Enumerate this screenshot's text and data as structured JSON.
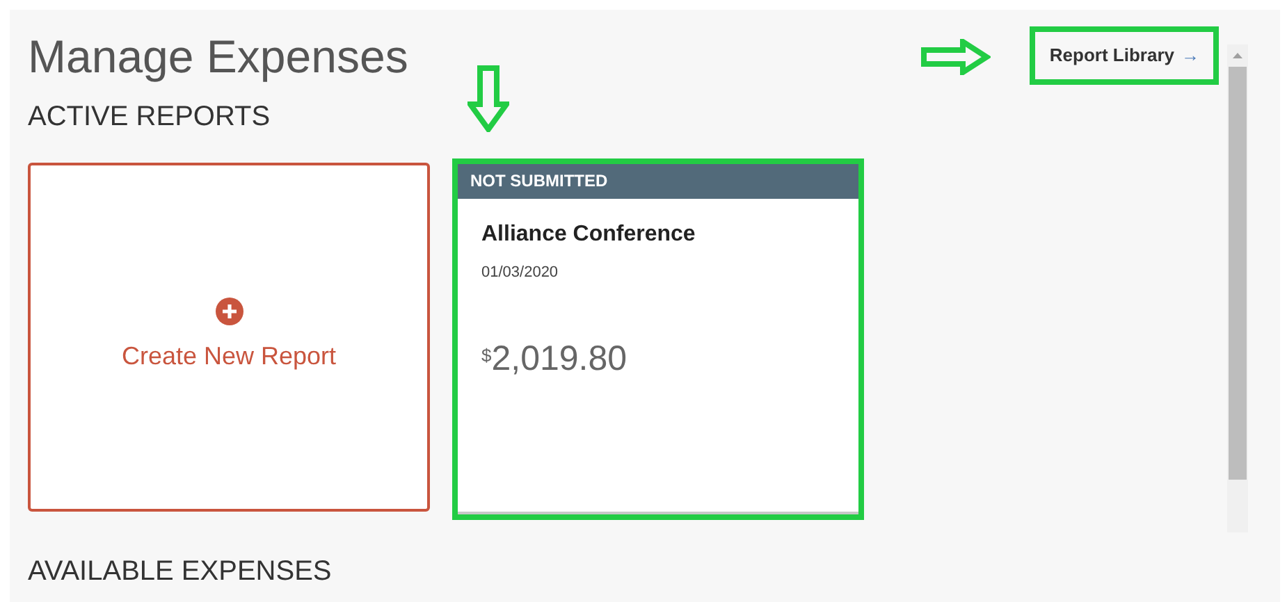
{
  "title": "Manage Expenses",
  "report_library": {
    "label": "Report Library",
    "arrow": "→"
  },
  "active_reports": {
    "heading": "ACTIVE REPORTS",
    "create_card": {
      "label": "Create New Report"
    },
    "reports": [
      {
        "status": "NOT SUBMITTED",
        "name": "Alliance Conference",
        "date": "01/03/2020",
        "currency": "$",
        "amount": "2,019.80"
      }
    ]
  },
  "available_expenses": {
    "heading": "AVAILABLE EXPENSES"
  }
}
